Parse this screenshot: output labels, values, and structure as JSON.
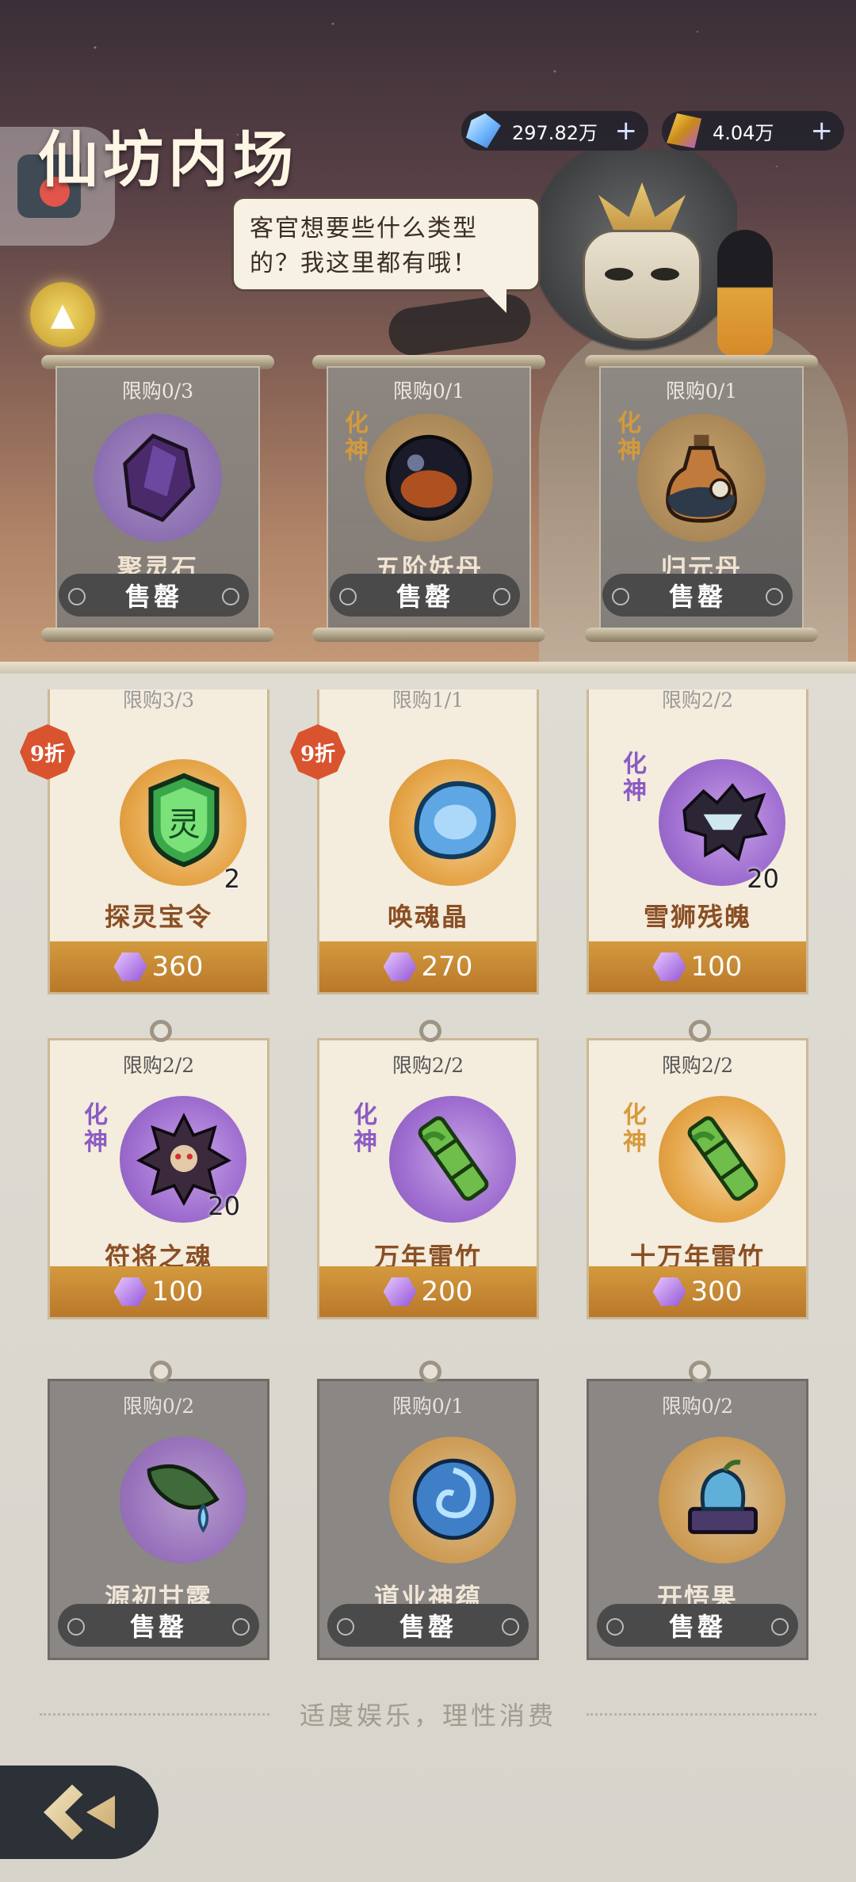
{
  "header": {
    "title": "仙坊内场",
    "speech": "客官想要些什么类型的？我这里都有哦！",
    "currencies": [
      {
        "icon": "spirit-crystal-icon",
        "amount": "297.82万",
        "add": "+"
      },
      {
        "icon": "gold-ticket-icon",
        "amount": "4.04万",
        "add": "+"
      }
    ],
    "fold_icon": "▲"
  },
  "featured": [
    {
      "limit": "限购0/3",
      "tier": "",
      "name": "聚灵石",
      "action": "售罄"
    },
    {
      "limit": "限购0/1",
      "tier": "化神",
      "name": "五阶妖丹",
      "action": "售罄"
    },
    {
      "limit": "限购0/1",
      "tier": "化神",
      "name": "归元丹",
      "action": "售罄"
    }
  ],
  "shop": [
    {
      "limit": "限购3/3",
      "badge": "9折",
      "tier": "",
      "name": "探灵宝令",
      "qty": "2",
      "price": "360",
      "disc": "orange"
    },
    {
      "limit": "限购1/1",
      "badge": "9折",
      "tier": "",
      "name": "唤魂晶",
      "qty": "",
      "price": "270",
      "disc": "orange"
    },
    {
      "limit": "限购2/2",
      "badge": "",
      "tier": "化神",
      "name": "雪狮残魄",
      "qty": "20",
      "price": "100",
      "disc": "purple"
    },
    {
      "limit": "限购2/2",
      "badge": "",
      "tier": "化神",
      "name": "符将之魂",
      "qty": "20",
      "price": "100",
      "disc": "purple"
    },
    {
      "limit": "限购2/2",
      "badge": "",
      "tier": "化神",
      "name": "万年雷竹",
      "qty": "",
      "price": "200",
      "disc": "purple"
    },
    {
      "limit": "限购2/2",
      "badge": "",
      "tier": "化神",
      "name": "十万年雷竹",
      "qty": "",
      "price": "300",
      "disc": "orange"
    }
  ],
  "soldout": [
    {
      "limit": "限购0/2",
      "name": "源初甘露",
      "action": "售罄"
    },
    {
      "limit": "限购0/1",
      "name": "道业神蕴",
      "action": "售罄"
    },
    {
      "limit": "限购0/2",
      "name": "开悟果",
      "action": "售罄"
    }
  ],
  "footer": {
    "note": "适度娱乐，理性消费"
  },
  "colors": {
    "price_bar": "#c98a34",
    "item_name": "#8a4f24",
    "badge": "#d9532f"
  }
}
